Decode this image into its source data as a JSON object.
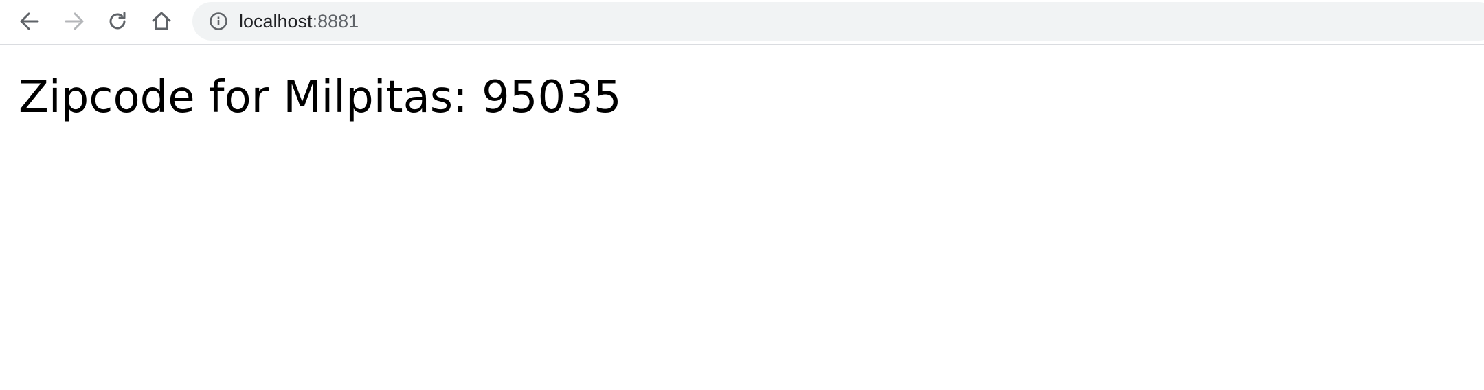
{
  "browser": {
    "nav": {
      "back_icon": "arrow-left-icon",
      "forward_icon": "arrow-right-icon",
      "reload_icon": "reload-icon",
      "home_icon": "home-icon"
    },
    "omnibox": {
      "site_info_icon": "info-icon",
      "host": "localhost",
      "port": ":8881"
    },
    "colors": {
      "icon_active": "#5f6368",
      "icon_disabled": "#b4b6b9",
      "omnibox_bg": "#f1f3f4"
    }
  },
  "page": {
    "heading": "Zipcode for Milpitas: 95035"
  }
}
